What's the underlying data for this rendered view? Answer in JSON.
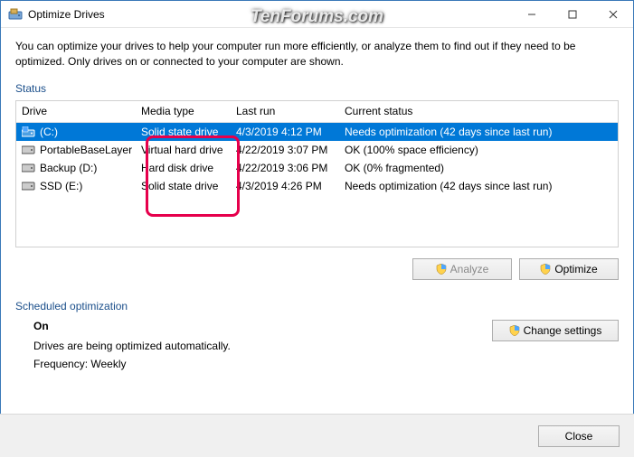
{
  "window": {
    "title": "Optimize Drives"
  },
  "watermark": "TenForums.com",
  "intro": "You can optimize your drives to help your computer run more efficiently, or analyze them to find out if they need to be optimized. Only drives on or connected to your computer are shown.",
  "status_label": "Status",
  "columns": {
    "drive": "Drive",
    "media": "Media type",
    "last": "Last run",
    "status": "Current status"
  },
  "rows": [
    {
      "drive": "(C:)",
      "media": "Solid state drive",
      "last": "4/3/2019 4:12 PM",
      "status": "Needs optimization (42 days since last run)",
      "selected": true,
      "icon": "os"
    },
    {
      "drive": "PortableBaseLayer ..",
      "media": "Virtual hard drive",
      "last": "4/22/2019 3:07 PM",
      "status": "OK (100% space efficiency)",
      "selected": false,
      "icon": "hdd"
    },
    {
      "drive": "Backup (D:)",
      "media": "Hard disk drive",
      "last": "4/22/2019 3:06 PM",
      "status": "OK (0% fragmented)",
      "selected": false,
      "icon": "hdd"
    },
    {
      "drive": "SSD (E:)",
      "media": "Solid state drive",
      "last": "4/3/2019 4:26 PM",
      "status": "Needs optimization (42 days since last run)",
      "selected": false,
      "icon": "hdd"
    }
  ],
  "buttons": {
    "analyze": "Analyze",
    "optimize": "Optimize",
    "change": "Change settings",
    "close": "Close"
  },
  "sched": {
    "label": "Scheduled optimization",
    "on": "On",
    "desc": "Drives are being optimized automatically.",
    "freq": "Frequency: Weekly"
  }
}
